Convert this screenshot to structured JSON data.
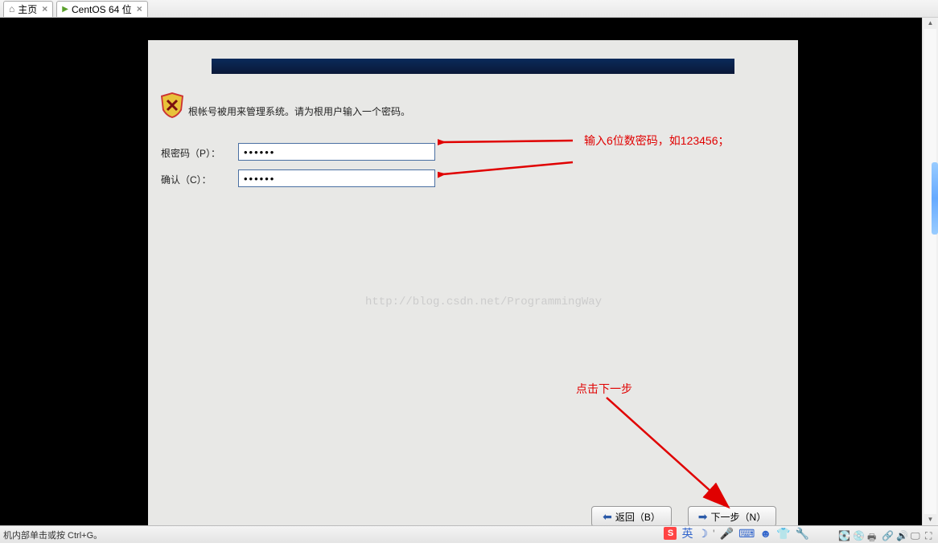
{
  "tabs": [
    {
      "label": "主页",
      "close": "×"
    },
    {
      "label": "CentOS 64 位",
      "close": "×"
    }
  ],
  "installer": {
    "instruction": "根帐号被用来管理系统。请为根用户输入一个密码。",
    "password_label": "根密码（P）：",
    "confirm_label": "确认（C）：",
    "password_value": "••••••",
    "confirm_value": "••••••",
    "back_button": "返回（B）",
    "next_button": "下一步（N）"
  },
  "annotations": {
    "password_hint": "输入6位数密码，如123456；",
    "next_hint": "点击下一步"
  },
  "watermark": "http://blog.csdn.net/ProgrammingWay",
  "statusbar": {
    "hint": "机内部单击或按 Ctrl+G。"
  },
  "ime": {
    "sogou": "S",
    "lang": "英"
  }
}
